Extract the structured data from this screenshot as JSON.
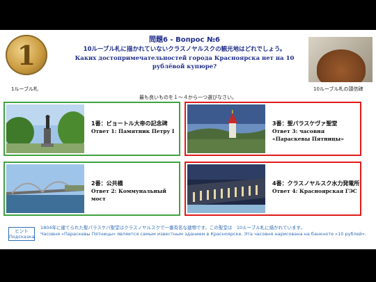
{
  "header": {
    "title_line1": "問題6 - Вопрос №6",
    "title_line2": "10ルーブル札に描かれていないクラスノヤルスクの観光地はどれでしょう。",
    "title_line3": "Каких достопримечательностей города Красноярска нет на 10 рублёвой купюре?"
  },
  "images": {
    "coin_caption": "1ルーブル札",
    "coin_glyph": "1",
    "plaque_caption": "10ルーブル札の頭信碑"
  },
  "instruction": "最も良いものを１～４から一つ選びなさい。",
  "options": [
    {
      "jp": "1番：ピョートル大帝の記念碑",
      "ru": "Ответ 1: Памятник Петру I",
      "border": "#3fa33f"
    },
    {
      "jp": "3番：聖パラスケヴァ聖堂",
      "ru": "Ответ 3: часовня «Параскевы Пятницы»",
      "border": "#e01b1b"
    },
    {
      "jp": "2番：公共橋",
      "ru": "Ответ 2: Коммунальный мост",
      "border": "#3fa33f"
    },
    {
      "jp": "4番：クラスノヤルスク水力発電所",
      "ru": "Ответ 4: Красноярская ГЭС",
      "border": "#e01b1b"
    }
  ],
  "hint": {
    "button_line1": "ヒント",
    "button_line2": "Подсказка",
    "text_jp": "1804年に建てられた聖パラスケバ聖堂はクラスノヤルスクで一番有名な建物です。この聖堂は　10ルーブル札に描かれています。",
    "text_ru": "Часовня «Параскевы Пятницы» является самым известным зданием в Красноярске. Эта часовня нарисована на банкноте «10 рублей»."
  },
  "colors": {
    "title": "#1f2d8a",
    "hint": "#2f6db5",
    "correct_border": "#3fa33f",
    "wrong_border": "#e01b1b"
  }
}
